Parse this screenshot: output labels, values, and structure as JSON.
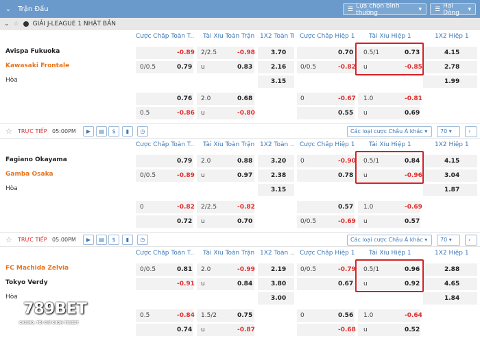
{
  "topbar": {
    "title": "Trận Đấu",
    "sort_label": "Lựa chọn bình thường",
    "odds_label": "Hai Dòng"
  },
  "league": {
    "name": "GIẢI J-LEAGUE 1 NHẬT BẢN"
  },
  "headers": [
    [
      "Cược Chấp Toàn T...",
      "Tài Xỉu Toàn Trận",
      "1X2 Toàn Trận",
      "Cược Chấp Hiệp 1",
      "Tài Xỉu Hiệp 1",
      "1X2 Hiệp 1"
    ],
    [
      "Cược Chấp Toàn T...",
      "Tài Xỉu Toàn Trận",
      "1X2 Toàn ...",
      "Cược Chấp Hiệp 1",
      "Tài Xỉu Hiệp 1",
      "1X2 Hiệp 1"
    ],
    [
      "Cược Chấp Toàn T...",
      "Tài Xỉu Toàn Trận",
      "1X2 Toàn ...",
      "Cược Chấp Hiệp 1",
      "Tài Xỉu Hiệp 1",
      "1X2 Hiệp 1"
    ]
  ],
  "live": {
    "label": "TRỰC TIẾP",
    "time": "05:00PM",
    "market_select": "Các loại cược Châu Á khác",
    "count_select": "70",
    "more_label": "›"
  },
  "matches": [
    {
      "home": "Avispa Fukuoka",
      "away": "Kawasaki Frontale",
      "draw": "Hòa",
      "rows": [
        [
          "",
          "-0.89",
          "2/2.5",
          "-0.98",
          "3.70",
          "",
          "0.70",
          "0.5/1",
          "0.73",
          "4.15"
        ],
        [
          "0/0.5",
          "0.79",
          "u",
          "0.83",
          "2.16",
          "0/0.5",
          "-0.82",
          "u",
          "-0.85",
          "2.78"
        ],
        [
          "",
          "",
          "",
          "",
          "3.15",
          "",
          "",
          "",
          "",
          "1.99"
        ],
        [
          "",
          "0.76",
          "2.0",
          "0.68",
          "",
          "0",
          "-0.67",
          "1.0",
          "-0.81",
          ""
        ],
        [
          "0.5",
          "-0.86",
          "u",
          "-0.80",
          "",
          "",
          "0.55",
          "u",
          "0.69",
          ""
        ]
      ]
    },
    {
      "home": "Fagiano Okayama",
      "away": "Gamba Osaka",
      "draw": "Hòa",
      "rows": [
        [
          "",
          "0.79",
          "2.0",
          "0.88",
          "3.20",
          "0",
          "-0.90",
          "0.5/1",
          "0.84",
          "4.15"
        ],
        [
          "0/0.5",
          "-0.89",
          "u",
          "0.97",
          "2.38",
          "",
          "0.78",
          "u",
          "-0.96",
          "3.04"
        ],
        [
          "",
          "",
          "",
          "",
          "3.15",
          "",
          "",
          "",
          "",
          "1.87"
        ],
        [
          "0",
          "-0.82",
          "2/2.5",
          "-0.82",
          "",
          "",
          "0.57",
          "1.0",
          "-0.69",
          ""
        ],
        [
          "",
          "0.72",
          "u",
          "0.70",
          "",
          "0/0.5",
          "-0.69",
          "u",
          "0.57",
          ""
        ]
      ]
    },
    {
      "home": "FC Machida Zelvia",
      "away": "Tokyo Verdy",
      "draw": "Hòa",
      "rows": [
        [
          "0/0.5",
          "0.81",
          "2.0",
          "-0.99",
          "2.19",
          "0/0.5",
          "-0.79",
          "0.5/1",
          "0.96",
          "2.88"
        ],
        [
          "",
          "-0.91",
          "u",
          "0.84",
          "3.80",
          "",
          "0.67",
          "u",
          "0.92",
          "4.65"
        ],
        [
          "",
          "",
          "",
          "",
          "3.00",
          "",
          "",
          "",
          "",
          "1.84"
        ],
        [
          "0.5",
          "-0.84",
          "1.5/2",
          "0.75",
          "",
          "0",
          "0.56",
          "1.0",
          "-0.64",
          ""
        ],
        [
          "",
          "0.74",
          "u",
          "-0.87",
          "",
          "",
          "-0.68",
          "u",
          "0.52",
          ""
        ]
      ]
    }
  ],
  "brand": {
    "logo": "789BET",
    "slogan": "CASINO, TÔI CHỈ CHỌN 789BET"
  },
  "colors": {
    "header_bar": "#6a9acb",
    "accent_blue": "#3d78b8",
    "negative": "#e03030",
    "team_highlight": "#e8731a",
    "highlight_box": "#d71f26"
  }
}
